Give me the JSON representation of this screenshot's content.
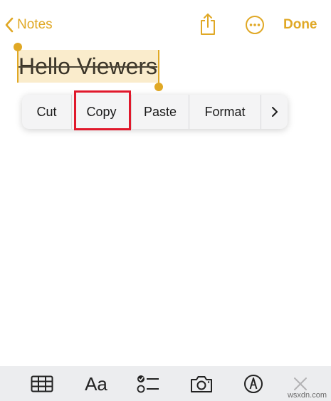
{
  "nav": {
    "back_label": "Notes",
    "done_label": "Done",
    "accent_color": "#e0a825"
  },
  "note": {
    "text": "Hello Viewers",
    "selected": true,
    "strikethrough": true,
    "selection_color": "#faeccc"
  },
  "edit_menu": {
    "items": [
      "Cut",
      "Copy",
      "Paste",
      "Format"
    ],
    "more_icon": "chevron-right-icon",
    "highlighted_item": "Copy",
    "highlight_color": "#e0182b"
  },
  "toolbar": {
    "icons": [
      "table-icon",
      "text-format-icon",
      "checklist-icon",
      "camera-icon",
      "markup-icon",
      "close-icon"
    ],
    "format_label": "Aa",
    "background": "#ecedef"
  },
  "watermark": "wsxdn.com"
}
